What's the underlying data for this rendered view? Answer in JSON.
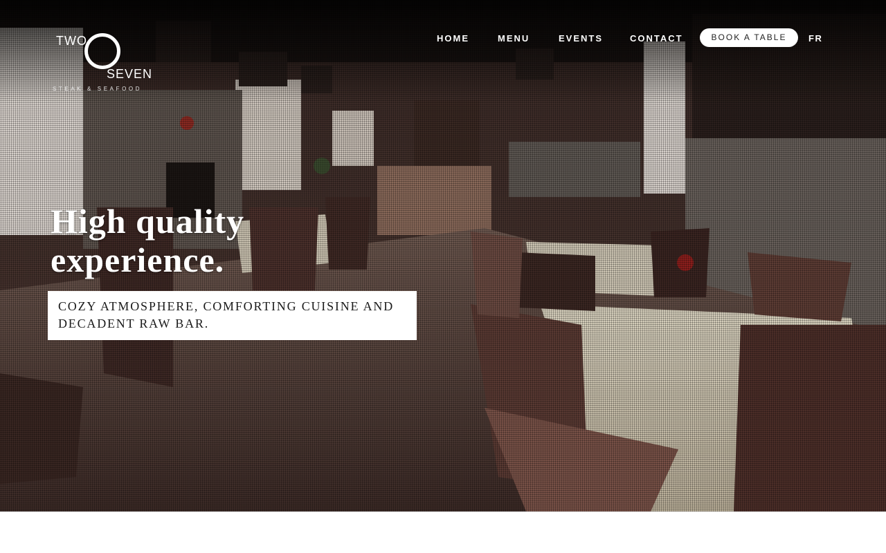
{
  "brand": {
    "logo_word_top": "TWO",
    "logo_word_bottom": "SEVEN",
    "logo_tagline": "STEAK & SEAFOOD"
  },
  "nav": {
    "items": [
      {
        "label": "HOME"
      },
      {
        "label": "MENU"
      },
      {
        "label": "EVENTS"
      },
      {
        "label": "CONTACT"
      }
    ],
    "book_label": "BOOK A TABLE",
    "lang_label": "FR"
  },
  "hero": {
    "headline": "High quality experience.",
    "subtitle": "COZY ATMOSPHERE, COMFORTING CUISINE AND DECADENT RAW BAR.",
    "background_description_icon": "restaurant-dining-room-photo"
  },
  "colors": {
    "text_light": "#ffffff",
    "button_bg": "#ffffff",
    "button_text": "#222222"
  }
}
